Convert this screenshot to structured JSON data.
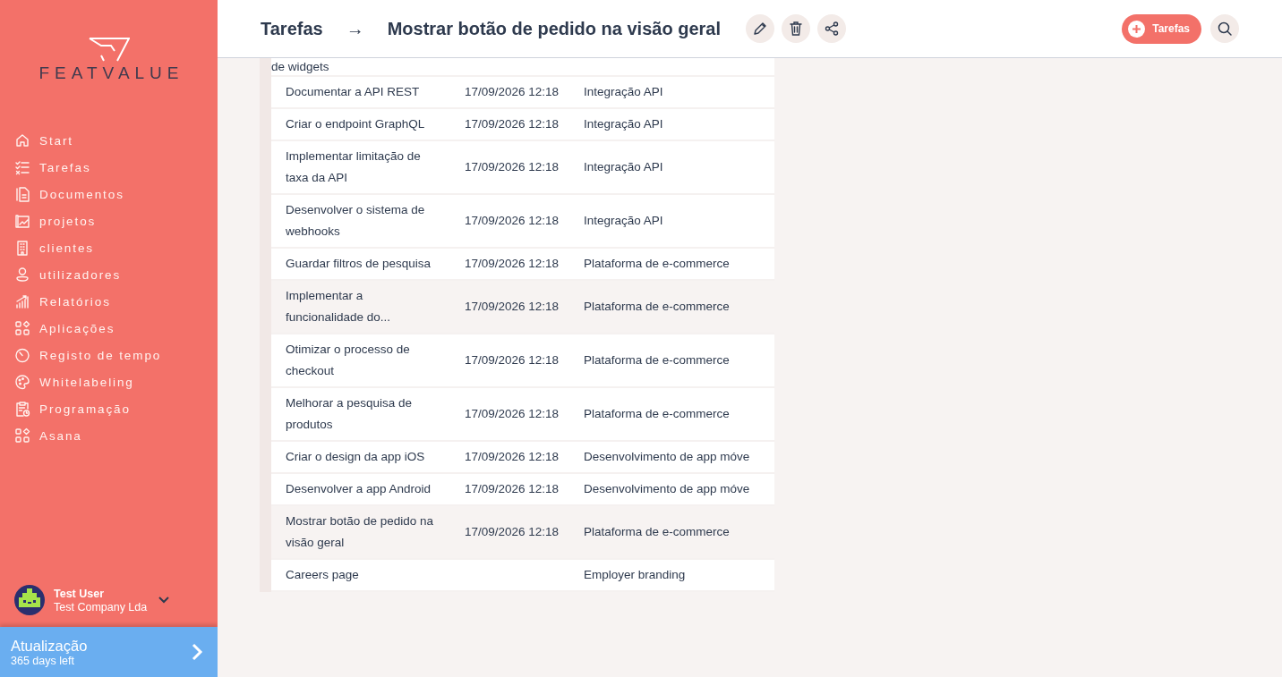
{
  "sidebar": {
    "logo": "FEATVALUE",
    "items": [
      {
        "label": "Start"
      },
      {
        "label": "Tarefas"
      },
      {
        "label": "Documentos"
      },
      {
        "label": "projetos"
      },
      {
        "label": "clientes"
      },
      {
        "label": "utilizadores"
      },
      {
        "label": "Relatórios"
      },
      {
        "label": "Aplicações"
      },
      {
        "label": "Registo de tempo"
      },
      {
        "label": "Whitelabeling"
      },
      {
        "label": "Programação"
      },
      {
        "label": "Asana"
      }
    ],
    "user": {
      "name": "Test User",
      "company": "Test Company Lda"
    },
    "upgrade": {
      "title": "Atualização",
      "subtitle": "365 days left"
    }
  },
  "header": {
    "breadcrumb": "Tarefas",
    "arrow": "→",
    "title": "Mostrar botão de pedido na visão geral",
    "add_button": "Tarefas"
  },
  "table": {
    "rows": [
      {
        "name": "de widgets",
        "selected": false
      },
      {
        "name": "Documentar a API REST",
        "date": "17/09/2026 12:18",
        "project": "Integração API",
        "selected": false
      },
      {
        "name": "Criar o endpoint GraphQL",
        "date": "17/09/2026 12:18",
        "project": "Integração API",
        "selected": false
      },
      {
        "name": "Implementar limitação de taxa da API",
        "date": "17/09/2026 12:18",
        "project": "Integração API",
        "selected": false
      },
      {
        "name": "Desenvolver o sistema de webhooks",
        "date": "17/09/2026 12:18",
        "project": "Integração API",
        "selected": false
      },
      {
        "name": "Guardar filtros de pesquisa",
        "date": "17/09/2026 12:18",
        "project": "Plataforma de e-commerce",
        "selected": false
      },
      {
        "name": "Implementar a funcionalidade do...",
        "date": "17/09/2026 12:18",
        "project": "Plataforma de e-commerce",
        "selected": true
      },
      {
        "name": "Otimizar o processo de checkout",
        "date": "17/09/2026 12:18",
        "project": "Plataforma de e-commerce",
        "selected": false
      },
      {
        "name": "Melhorar a pesquisa de produtos",
        "date": "17/09/2026 12:18",
        "project": "Plataforma de e-commerce",
        "selected": false
      },
      {
        "name": "Criar o design da app iOS",
        "date": "17/09/2026 12:18",
        "project": "Desenvolvimento de app móve",
        "selected": false
      },
      {
        "name": "Desenvolver a app Android",
        "date": "17/09/2026 12:18",
        "project": "Desenvolvimento de app móve",
        "selected": false
      },
      {
        "name": "Mostrar botão de pedido na visão geral",
        "date": "17/09/2026 12:18",
        "project": "Plataforma de e-commerce",
        "selected": true
      },
      {
        "name": "Careers page",
        "project": "Employer branding",
        "selected": false
      }
    ]
  }
}
